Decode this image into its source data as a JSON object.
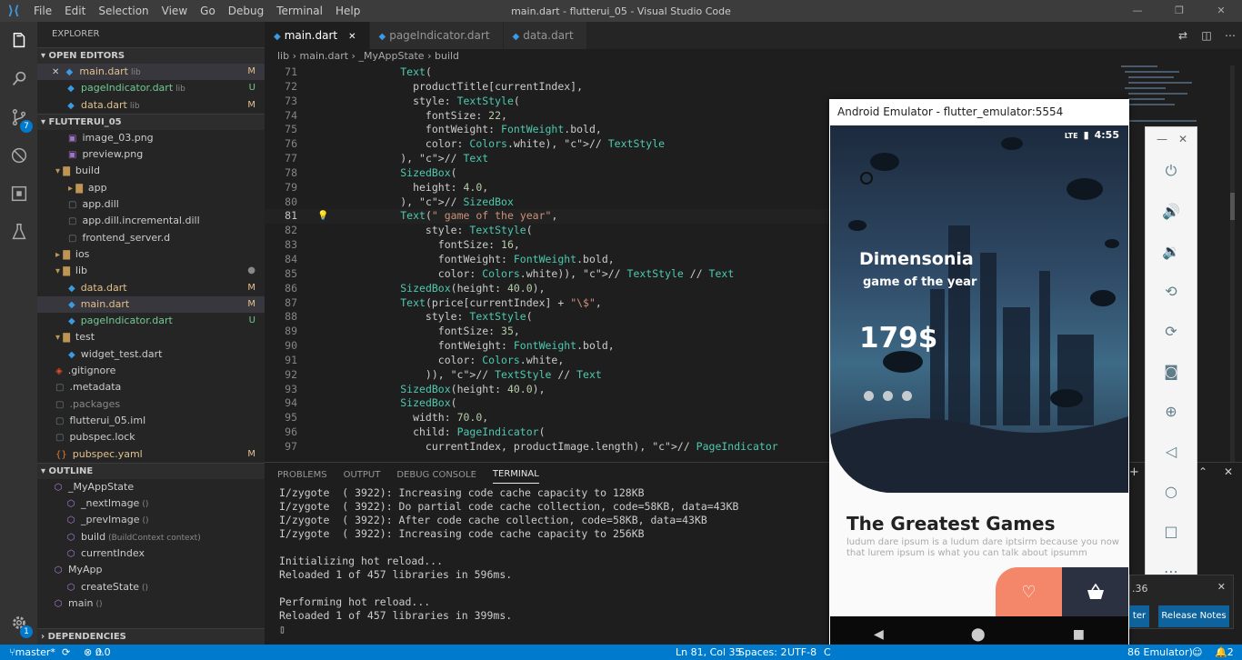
{
  "window": {
    "title": "main.dart - flutterui_05 - Visual Studio Code",
    "menu": [
      "File",
      "Edit",
      "Selection",
      "View",
      "Go",
      "Debug",
      "Terminal",
      "Help"
    ]
  },
  "activity": {
    "scm_badge": "7",
    "settings_badge": "1"
  },
  "explorer": {
    "title": "EXPLORER",
    "open_editors_label": "OPEN EDITORS",
    "open_editors": [
      {
        "name": "main.dart",
        "dir": "lib",
        "status": "M"
      },
      {
        "name": "pageIndicator.dart",
        "dir": "lib",
        "status": "U"
      },
      {
        "name": "data.dart",
        "dir": "lib",
        "status": "M"
      }
    ],
    "project_label": "FLUTTERUI_05",
    "tree": [
      {
        "name": "image_03.png",
        "indent": 2,
        "icon": "image-icon",
        "status": ""
      },
      {
        "name": "preview.png",
        "indent": 2,
        "icon": "image-icon",
        "status": ""
      },
      {
        "name": "build",
        "indent": 1,
        "icon": "folder-open-icon",
        "status": ""
      },
      {
        "name": "app",
        "indent": 2,
        "icon": "folder-icon",
        "status": ""
      },
      {
        "name": "app.dill",
        "indent": 2,
        "icon": "file-icon",
        "status": ""
      },
      {
        "name": "app.dill.incremental.dill",
        "indent": 2,
        "icon": "file-icon",
        "status": ""
      },
      {
        "name": "frontend_server.d",
        "indent": 2,
        "icon": "file-icon",
        "status": ""
      },
      {
        "name": "ios",
        "indent": 1,
        "icon": "folder-icon",
        "status": ""
      },
      {
        "name": "lib",
        "indent": 1,
        "icon": "folder-open-icon",
        "status": "●"
      },
      {
        "name": "data.dart",
        "indent": 2,
        "icon": "dart-icon",
        "status": "M"
      },
      {
        "name": "main.dart",
        "indent": 2,
        "icon": "dart-icon",
        "status": "M"
      },
      {
        "name": "pageIndicator.dart",
        "indent": 2,
        "icon": "dart-icon",
        "status": "U"
      },
      {
        "name": "test",
        "indent": 1,
        "icon": "folder-open-icon",
        "status": ""
      },
      {
        "name": "widget_test.dart",
        "indent": 2,
        "icon": "dart-icon",
        "status": ""
      },
      {
        "name": ".gitignore",
        "indent": 1,
        "icon": "git-icon",
        "status": ""
      },
      {
        "name": ".metadata",
        "indent": 1,
        "icon": "file-icon",
        "status": ""
      },
      {
        "name": ".packages",
        "indent": 1,
        "icon": "file-icon",
        "status": ""
      },
      {
        "name": "flutterui_05.iml",
        "indent": 1,
        "icon": "file-icon",
        "status": ""
      },
      {
        "name": "pubspec.lock",
        "indent": 1,
        "icon": "file-icon",
        "status": ""
      },
      {
        "name": "pubspec.yaml",
        "indent": 1,
        "icon": "yaml-icon",
        "status": "M"
      }
    ],
    "outline_label": "OUTLINE",
    "outline": [
      {
        "name": "_MyAppState",
        "detail": "",
        "indent": 1
      },
      {
        "name": "_nextImage",
        "detail": "()",
        "indent": 2
      },
      {
        "name": "_prevImage",
        "detail": "()",
        "indent": 2
      },
      {
        "name": "build",
        "detail": "(BuildContext context)",
        "indent": 2
      },
      {
        "name": "currentIndex",
        "detail": "",
        "indent": 2
      },
      {
        "name": "MyApp",
        "detail": "",
        "indent": 1
      },
      {
        "name": "createState",
        "detail": "()",
        "indent": 2
      },
      {
        "name": "main",
        "detail": "()",
        "indent": 1
      }
    ],
    "dependencies_label": "DEPENDENCIES"
  },
  "tabs": [
    {
      "label": "main.dart",
      "active": true
    },
    {
      "label": "pageIndicator.dart",
      "active": false
    },
    {
      "label": "data.dart",
      "active": false
    }
  ],
  "breadcrumb": [
    "lib",
    "main.dart",
    "_MyAppState",
    "build"
  ],
  "code": [
    {
      "n": "71",
      "t": "          Text("
    },
    {
      "n": "72",
      "t": "            productTitle[currentIndex],"
    },
    {
      "n": "73",
      "t": "            style: TextStyle("
    },
    {
      "n": "74",
      "t": "              fontSize: 22,"
    },
    {
      "n": "75",
      "t": "              fontWeight: FontWeight.bold,"
    },
    {
      "n": "76",
      "t": "              color: Colors.white), // TextStyle"
    },
    {
      "n": "77",
      "t": "          ), // Text"
    },
    {
      "n": "78",
      "t": "          SizedBox("
    },
    {
      "n": "79",
      "t": "            height: 4.0,"
    },
    {
      "n": "80",
      "t": "          ), // SizedBox"
    },
    {
      "n": "81",
      "t": "          Text(\" game of the year\","
    },
    {
      "n": "82",
      "t": "              style: TextStyle("
    },
    {
      "n": "83",
      "t": "                fontSize: 16,"
    },
    {
      "n": "84",
      "t": "                fontWeight: FontWeight.bold,"
    },
    {
      "n": "85",
      "t": "                color: Colors.white)), // TextStyle // Text"
    },
    {
      "n": "86",
      "t": "          SizedBox(height: 40.0),"
    },
    {
      "n": "87",
      "t": "          Text(price[currentIndex] + \"\\$\","
    },
    {
      "n": "88",
      "t": "              style: TextStyle("
    },
    {
      "n": "89",
      "t": "                fontSize: 35,"
    },
    {
      "n": "90",
      "t": "                fontWeight: FontWeight.bold,"
    },
    {
      "n": "91",
      "t": "                color: Colors.white,"
    },
    {
      "n": "92",
      "t": "              )), // TextStyle // Text"
    },
    {
      "n": "93",
      "t": "          SizedBox(height: 40.0),"
    },
    {
      "n": "94",
      "t": "          SizedBox("
    },
    {
      "n": "95",
      "t": "            width: 70.0,"
    },
    {
      "n": "96",
      "t": "            child: PageIndicator("
    },
    {
      "n": "97",
      "t": "              currentIndex, productImage.length), // PageIndicator"
    }
  ],
  "panel": {
    "tabs": [
      "PROBLEMS",
      "OUTPUT",
      "DEBUG CONSOLE",
      "TERMINAL"
    ],
    "active_tab": "TERMINAL",
    "lines": [
      "I/zygote  ( 3922): Increasing code cache capacity to 128KB",
      "I/zygote  ( 3922): Do partial code cache collection, code=58KB, data=43KB",
      "I/zygote  ( 3922): After code cache collection, code=58KB, data=43KB",
      "I/zygote  ( 3922): Increasing code cache capacity to 256KB",
      "",
      "Initializing hot reload...",
      "Reloaded 1 of 457 libraries in 596ms.",
      "",
      "Performing hot reload...",
      "Reloaded 1 of 457 libraries in 399ms."
    ]
  },
  "emulator": {
    "title": "Android Emulator - flutter_emulator:5554",
    "status_network": "LTE",
    "status_time": "4:55",
    "hero_title": "Dimensonia",
    "hero_subtitle": "game of the year",
    "hero_price": "179$",
    "section_title": "The Greatest Games",
    "section_desc": "ludum dare ipsum is a ludum dare iptsirm because you now that lurem ipsum is what you can talk about ipsumm"
  },
  "notification": {
    "text": ".36",
    "start_label": "ter",
    "release_notes": "Release Notes"
  },
  "status": {
    "branch": "master*",
    "errors": "0",
    "warnings": "0",
    "position": "Ln 81, Col 35",
    "spaces": "Spaces: 2",
    "encoding": "UTF-8",
    "eol": "C",
    "device": "86 Emulator)",
    "notifications": "2"
  }
}
